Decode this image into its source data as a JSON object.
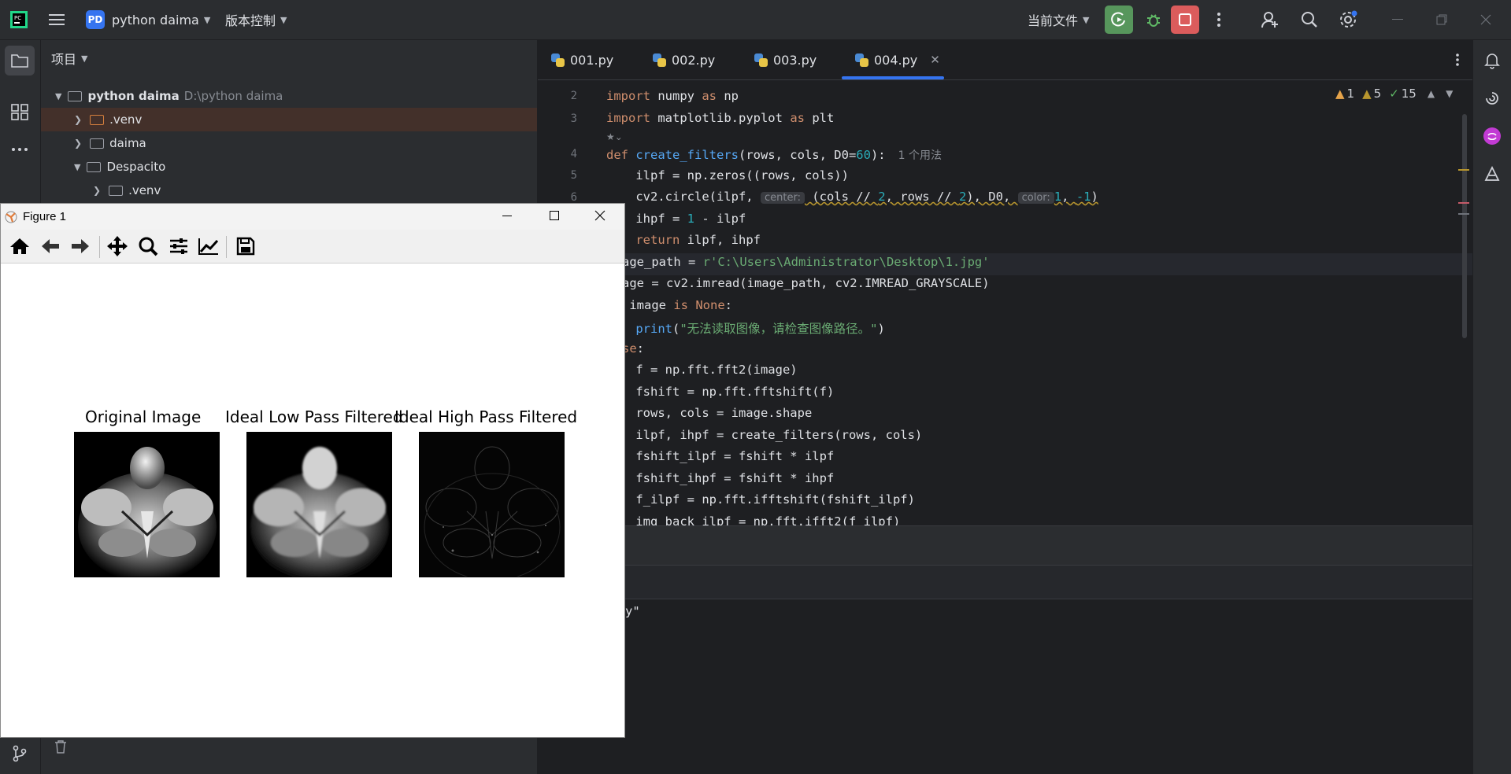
{
  "titlebar": {
    "project_badge": "PD",
    "project_name": "python daima",
    "vcs_label": "版本控制",
    "run_config": "当前文件",
    "icons": [
      "jetbrains-logo-icon",
      "hamburger-menu-icon",
      "run-icon",
      "debug-icon",
      "stop-icon",
      "more-vert-icon",
      "add-user-icon",
      "search-icon",
      "settings-icon",
      "minimize-icon",
      "restore-icon",
      "close-icon"
    ],
    "colors": {
      "run": "#57965c",
      "stop": "#db5c5c",
      "debug": "#5fb865"
    }
  },
  "project_panel": {
    "title": "项目",
    "tree": [
      {
        "name": "python daima",
        "path": "D:\\python daima",
        "expanded": true,
        "level": 0
      },
      {
        "name": ".venv",
        "level": 1,
        "expanded": false,
        "highlight": true
      },
      {
        "name": "daima",
        "level": 1,
        "expanded": false
      },
      {
        "name": "Despacito",
        "level": 1,
        "expanded": true
      },
      {
        "name": ".venv",
        "level": 2,
        "expanded": false
      }
    ]
  },
  "tabs": [
    {
      "label": "001.py"
    },
    {
      "label": "002.py"
    },
    {
      "label": "003.py"
    },
    {
      "label": "004.py",
      "active": true
    }
  ],
  "inspections": {
    "errors": "1",
    "warnings": "5",
    "weak": "15"
  },
  "code": {
    "line_numbers": [
      "2",
      "3",
      "4",
      "5",
      "6"
    ],
    "l2": {
      "kw1": "import",
      "rest": " numpy ",
      "kw2": "as",
      "alias": " np"
    },
    "l3": {
      "kw1": "import",
      "rest": " matplotlib.pyplot ",
      "kw2": "as",
      "alias": " plt"
    },
    "l4": {
      "kw": "def",
      "name": " create_filters",
      "p1": "(rows, cols, D0=",
      "num": "60",
      "p2": "):",
      "usage": "1 个用法"
    },
    "l5": "    ilpf = np.zeros((rows, cols))",
    "l6": {
      "pre": "    cv2.circle(ilpf, ",
      "hint1": "center:",
      "mid": " (cols // ",
      "n2": "2",
      ", rows // ": "",
      "mid2": ", rows // ",
      "n3": "2",
      "post": "), D0, ",
      "hint2": "color:",
      "n4": "1",
      "sep": ", ",
      "n5": "-1",
      ")": ")"
    },
    "l7": {
      "pre": "    ihpf = ",
      "num": "1",
      "post": " - ilpf"
    },
    "l8": {
      "kw": "    return",
      "post": " ilpf, ihpf"
    },
    "l9": {
      "pre": "age_path = ",
      "str": "r'C:\\Users\\Administrator\\Desktop\\1.jpg'"
    },
    "l10": "age = cv2.imread(image_path, cv2.IMREAD_GRAYSCALE)",
    "l11": {
      "pre": " image ",
      "kw1": "is",
      "kw2": " None",
      ":": ":"
    },
    "l12": {
      "fn": "    print",
      "p1": "(",
      "str": "\"无法读取图像，请检查图像路径。\"",
      "p2": ")"
    },
    "l13": {
      "kw": "se",
      ":": ":"
    },
    "l14": "    f = np.fft.fft2(image)",
    "l15": "    fshift = np.fft.fftshift(f)",
    "l16": "    rows, cols = image.shape",
    "l17": "    ilpf, ihpf = create_filters(rows, cols)",
    "l18": "    fshift_ilpf = fshift * ilpf",
    "l19": "    fshift_ihpf = fshift * ihpf",
    "l20": "    f_ilpf = np.fft.ifftshift(fshift_ilpf)",
    "l21": "    img_back_ilpf = np.fft.ifft2(f_ilpf)",
    "terminal_fragment": "y\""
  },
  "figure": {
    "title": "Figure 1",
    "toolbar": [
      "home-icon",
      "back-arrow-icon",
      "forward-arrow-icon",
      "pan-icon",
      "zoom-icon",
      "configure-subplots-icon",
      "edit-axis-icon",
      "save-icon"
    ],
    "subplots": [
      {
        "title": "Original Image"
      },
      {
        "title": "Ideal Low Pass Filtered"
      },
      {
        "title": "Ideal High Pass Filtered"
      }
    ]
  }
}
